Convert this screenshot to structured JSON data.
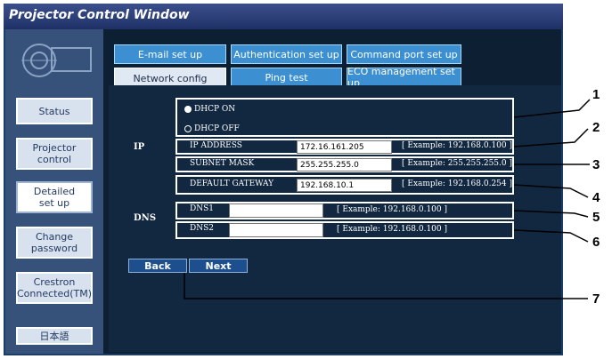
{
  "window": {
    "title": "Projector Control Window"
  },
  "sidebar": {
    "items": [
      {
        "label": "Status"
      },
      {
        "label": "Projector control"
      },
      {
        "label": "Detailed set up"
      },
      {
        "label": "Change password"
      },
      {
        "label": "Crestron Connected(TM)"
      },
      {
        "label": "日本語"
      }
    ]
  },
  "tabs": {
    "row1": [
      "E-mail set up",
      "Authentication set up",
      "Command port set up"
    ],
    "row2": [
      "Network config",
      "Ping test",
      "ECO management set up"
    ],
    "active": "Network config"
  },
  "network": {
    "ip_section": "IP",
    "dhcp_on": "DHCP ON",
    "dhcp_off": "DHCP OFF",
    "ip_address": {
      "label": "IP ADDRESS",
      "value": "172.16.161.205",
      "example": "[ Example: 192.168.0.100 ]"
    },
    "subnet_mask": {
      "label": "SUBNET MASK",
      "value": "255.255.255.0",
      "example": "[ Example: 255.255.255.0 ]"
    },
    "default_gateway": {
      "label": "DEFAULT GATEWAY",
      "value": "192.168.10.1",
      "example": "[ Example: 192.168.0.254 ]"
    },
    "dns_section": "DNS",
    "dns1": {
      "label": "DNS1",
      "value": "",
      "example": "[ Example: 192.168.0.100 ]"
    },
    "dns2": {
      "label": "DNS2",
      "value": "",
      "example": "[ Example: 192.168.0.100 ]"
    }
  },
  "nav": {
    "back": "Back",
    "next": "Next"
  },
  "callouts": [
    "1",
    "2",
    "3",
    "4",
    "5",
    "6",
    "7"
  ]
}
